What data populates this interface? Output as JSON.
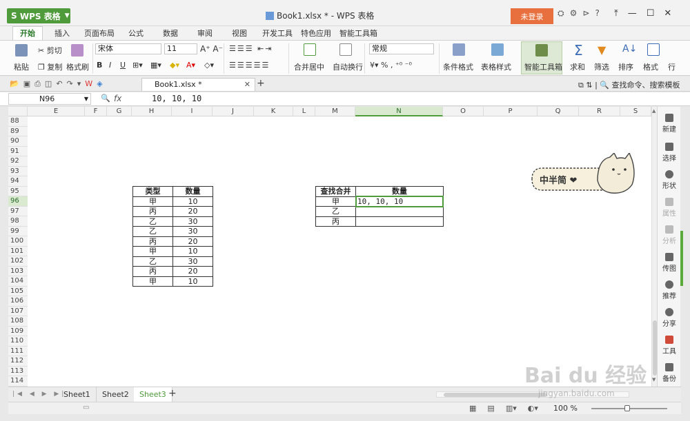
{
  "app": {
    "name": "WPS 表格",
    "window_title": "Book1.xlsx * - WPS 表格",
    "login": "未登录"
  },
  "tabs": [
    "开始",
    "插入",
    "页面布局",
    "公式",
    "数据",
    "审阅",
    "视图",
    "开发工具",
    "特色应用",
    "智能工具箱"
  ],
  "ribbon": {
    "paste": "粘贴",
    "cut": "剪切",
    "copy": "复制",
    "format_painter": "格式刷",
    "font_name": "宋体",
    "font_size": "11",
    "merge_center": "合并居中",
    "wrap_text": "自动换行",
    "number_format": "常规",
    "conditional_format": "条件格式",
    "table_style": "表格样式",
    "smart_toolbox": "智能工具箱",
    "sum": "求和",
    "filter": "筛选",
    "sort": "排序",
    "format": "格式",
    "row_col": "行"
  },
  "doc_tab": "Book1.xlsx *",
  "search_hint": "查找命令、搜索模板",
  "formula_bar": {
    "name_box": "N96",
    "fx": "fx",
    "value": "10, 10, 10"
  },
  "columns": [
    "E",
    "F",
    "G",
    "H",
    "I",
    "J",
    "K",
    "L",
    "M",
    "N",
    "O",
    "P",
    "Q",
    "R",
    "S"
  ],
  "rows": [
    "88",
    "89",
    "90",
    "91",
    "92",
    "93",
    "94",
    "95",
    "96",
    "97",
    "98",
    "99",
    "100",
    "101",
    "102",
    "103",
    "104",
    "105",
    "106",
    "107",
    "108",
    "109",
    "110",
    "111",
    "112",
    "113",
    "114"
  ],
  "table1": {
    "headers": [
      "类型",
      "数量"
    ],
    "rows": [
      [
        "甲",
        "10"
      ],
      [
        "丙",
        "20"
      ],
      [
        "乙",
        "30"
      ],
      [
        "乙",
        "30"
      ],
      [
        "丙",
        "20"
      ],
      [
        "甲",
        "10"
      ],
      [
        "乙",
        "30"
      ],
      [
        "丙",
        "20"
      ],
      [
        "甲",
        "10"
      ]
    ]
  },
  "table2": {
    "headers": [
      "查找合并",
      "数量"
    ],
    "rows": [
      [
        "甲",
        "10, 10, 10"
      ],
      [
        "乙",
        ""
      ],
      [
        "丙",
        ""
      ]
    ]
  },
  "sticker_text": "中半简 ❤",
  "right_panel": [
    {
      "label": "新建",
      "dim": false
    },
    {
      "label": "选择",
      "dim": false
    },
    {
      "label": "形状",
      "dim": false
    },
    {
      "label": "属性",
      "dim": true
    },
    {
      "label": "分析",
      "dim": true
    },
    {
      "label": "传图",
      "dim": false
    },
    {
      "label": "推荐",
      "dim": false
    },
    {
      "label": "分享",
      "dim": false
    },
    {
      "label": "工具",
      "dim": false
    },
    {
      "label": "备份",
      "dim": false
    }
  ],
  "sheets": [
    "Sheet1",
    "Sheet2",
    "Sheet3"
  ],
  "active_sheet": "Sheet3",
  "status": {
    "zoom": "100 %"
  },
  "watermark": {
    "main": "Bai du 经验",
    "sub": "jingyan.baidu.com"
  },
  "colors": {
    "accent": "#4f9a3a",
    "login": "#e8703e"
  }
}
